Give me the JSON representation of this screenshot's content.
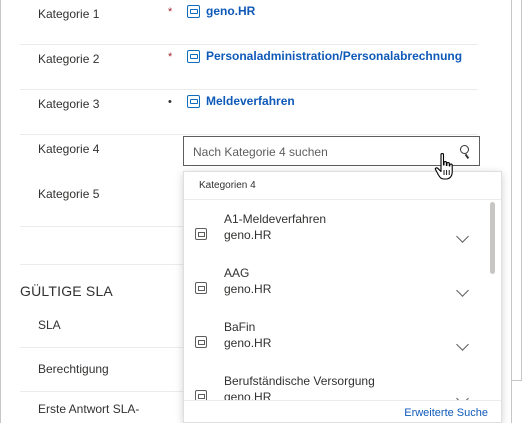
{
  "form": {
    "rows": [
      {
        "label": "Kategorie 1",
        "required": "*",
        "value": "geno.HR"
      },
      {
        "label": "Kategorie 2",
        "required": "*",
        "value": "Personaladministration/Personalabrechnung"
      },
      {
        "label": "Kategorie 3",
        "required": "•",
        "value": "Meldeverfahren"
      },
      {
        "label": "Kategorie 4",
        "required": "",
        "value": ""
      },
      {
        "label": "Kategorie 5",
        "required": "",
        "value": ""
      }
    ]
  },
  "search": {
    "placeholder": "Nach Kategorie 4 suchen",
    "icon": "search-icon"
  },
  "sla_section": {
    "title": "GÜLTIGE SLA",
    "fields": [
      "SLA",
      "Berechtigung",
      "Erste Antwort SLA-"
    ]
  },
  "dropdown": {
    "header": "Kategorien 4",
    "items": [
      {
        "title": "A1-Meldeverfahren",
        "subtitle": "geno.HR"
      },
      {
        "title": "AAG",
        "subtitle": "geno.HR"
      },
      {
        "title": "BaFin",
        "subtitle": "geno.HR"
      },
      {
        "title": "Berufständische Versorgung",
        "subtitle": "geno.HR"
      }
    ],
    "advanced_search": "Erweiterte Suche"
  },
  "colors": {
    "link": "#0f5ab8",
    "required": "#a4262c",
    "border": "#605e5c"
  }
}
